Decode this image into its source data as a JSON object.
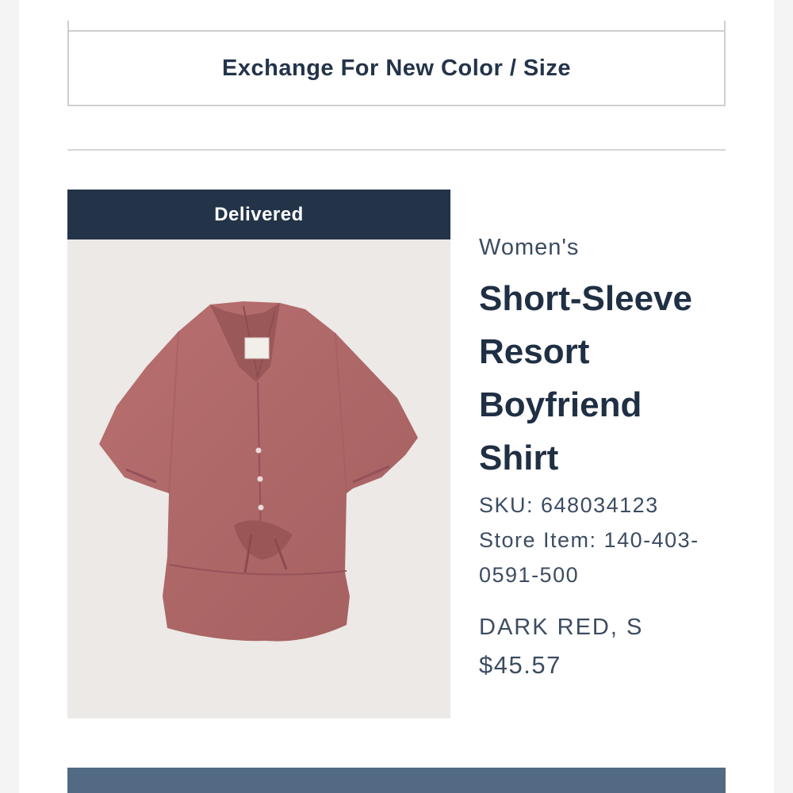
{
  "actions": {
    "exchange_label": "Exchange For New Color / Size"
  },
  "order_item": {
    "status": "Delivered",
    "category": "Women's",
    "title_lines": [
      "Short-Sleeve",
      "Resort",
      "Boyfriend",
      "Shirt"
    ],
    "sku": "SKU: 648034123",
    "store_item_line1": "Store Item: 140-403-",
    "store_item_line2": "0591-500",
    "variant": "DARK RED, S",
    "price": "$45.57",
    "image_name": "shirt-image"
  },
  "colors": {
    "navy": "#233449",
    "slate_blue": "#536a85",
    "shirt": "#b06c6b"
  }
}
